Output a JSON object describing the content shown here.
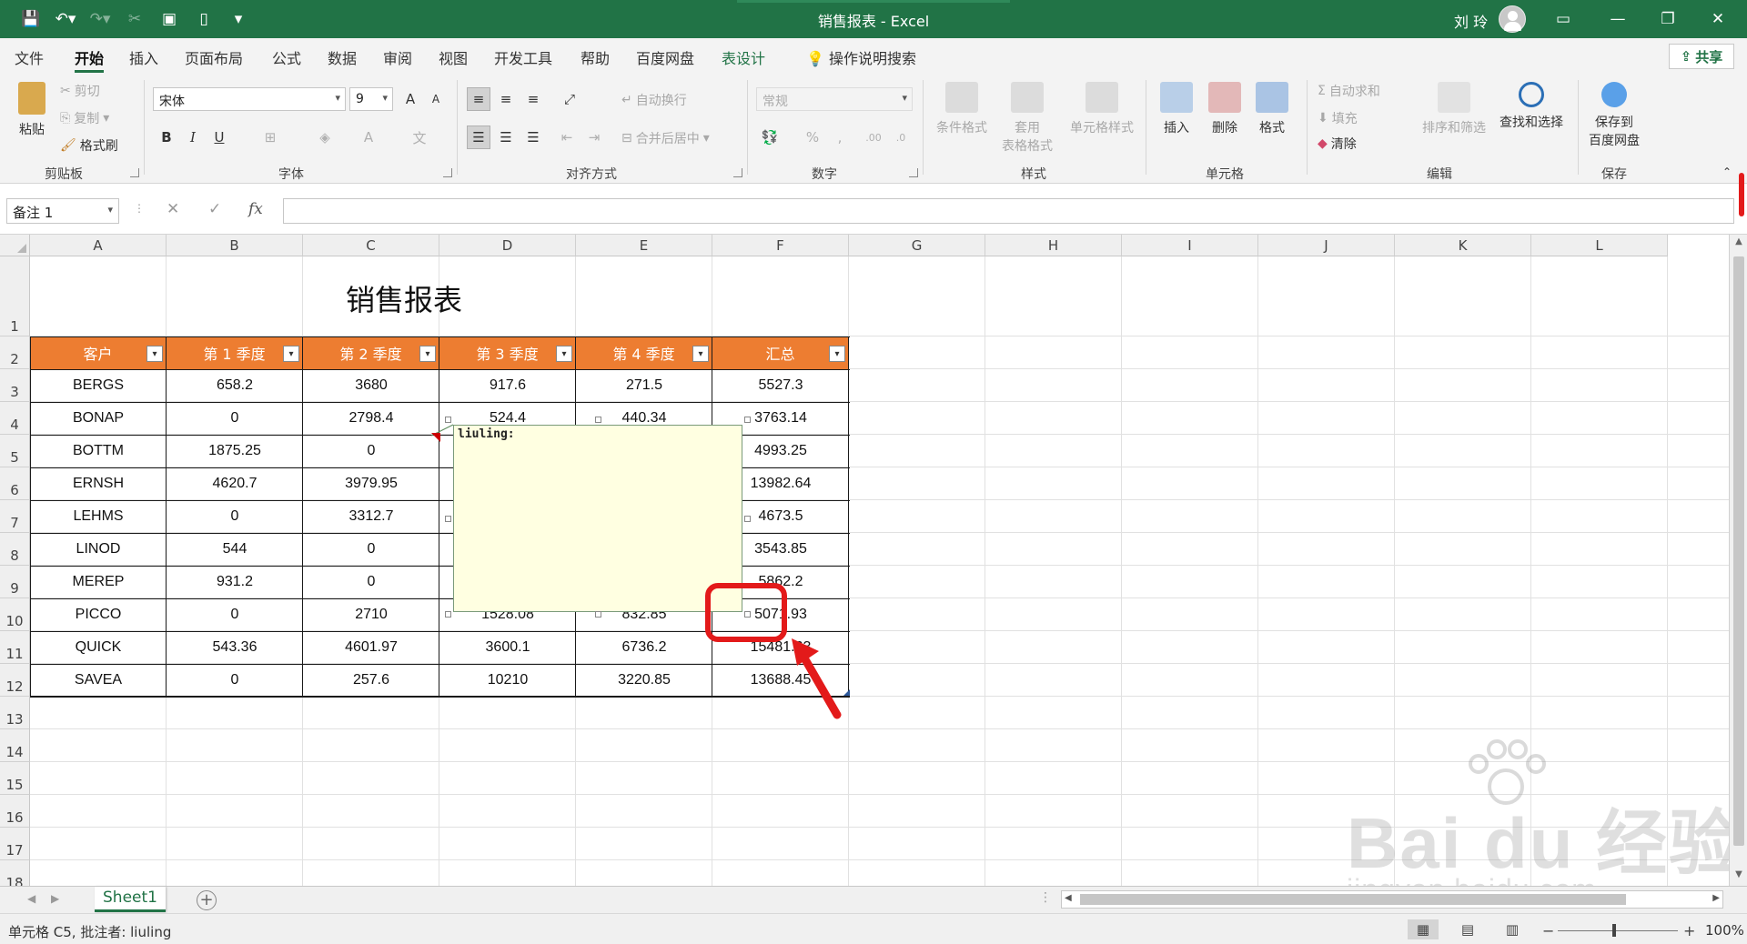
{
  "window": {
    "doc_title": "销售报表  -  Excel",
    "user": "刘 玲"
  },
  "qat": [
    "save-icon",
    "undo-icon",
    "redo-icon",
    "cut-icon",
    "print-preview-icon",
    "new-doc-icon",
    "customize-icon"
  ],
  "tabs": [
    "文件",
    "开始",
    "插入",
    "页面布局",
    "公式",
    "数据",
    "审阅",
    "视图",
    "开发工具",
    "帮助",
    "百度网盘",
    "表设计"
  ],
  "tell_me": "操作说明搜索",
  "share_label": "共享",
  "ribbon": {
    "clipboard": {
      "paste": "粘贴",
      "cut": "剪切",
      "copy": "复制",
      "format_painter": "格式刷",
      "label": "剪贴板"
    },
    "font": {
      "name": "宋体",
      "size": "9",
      "label": "字体",
      "grow": "A",
      "shrink": "A",
      "bold": "B",
      "italic": "I",
      "underline": "U",
      "font_color": "A",
      "phonetic": "文"
    },
    "alignment": {
      "wrap": "自动换行",
      "merge": "合并后居中",
      "label": "对齐方式"
    },
    "number": {
      "format": "常规",
      "percent": "%",
      "comma": ",",
      "label": "数字"
    },
    "styles": {
      "cond": "条件格式",
      "table1": "套用",
      "table2": "表格格式",
      "cell_styles": "单元格样式",
      "label": "样式"
    },
    "cells": {
      "insert": "插入",
      "delete": "删除",
      "format": "格式",
      "label": "单元格"
    },
    "editing": {
      "autosum": "自动求和",
      "fill": "填充",
      "clear": "清除",
      "sort": "排序和筛选",
      "find": "查找和选择",
      "label": "编辑"
    },
    "save": {
      "line1": "保存到",
      "line2": "百度网盘",
      "label": "保存"
    }
  },
  "formula_bar": {
    "name_box": "备注 1",
    "cancel": "✕",
    "enter": "✓",
    "fx": "fx",
    "content": ""
  },
  "columns": [
    "A",
    "B",
    "C",
    "D",
    "E",
    "F",
    "G",
    "H",
    "I",
    "J",
    "K",
    "L"
  ],
  "rows": [
    "1",
    "2",
    "3",
    "4",
    "5",
    "6",
    "7",
    "8",
    "9",
    "10",
    "11",
    "12",
    "13",
    "14",
    "15",
    "16",
    "17",
    "18"
  ],
  "sheet_title": "销售报表",
  "table": {
    "headers": [
      "客户",
      "第 1 季度",
      "第 2 季度",
      "第 3 季度",
      "第 4 季度",
      "汇总"
    ],
    "rows": [
      [
        "BERGS",
        "658.2",
        "3680",
        "917.6",
        "271.5",
        "5527.3"
      ],
      [
        "BONAP",
        "0",
        "2798.4",
        "524.4",
        "440.34",
        "3763.14"
      ],
      [
        "BOTTM",
        "1875.25",
        "0",
        "",
        "",
        "4993.25"
      ],
      [
        "ERNSH",
        "4620.7",
        "3979.95",
        "",
        "",
        "13982.64"
      ],
      [
        "LEHMS",
        "0",
        "3312.7",
        "",
        "",
        "4673.5"
      ],
      [
        "LINOD",
        "544",
        "0",
        "",
        "",
        "3543.85"
      ],
      [
        "MEREP",
        "931.2",
        "0",
        "",
        "",
        "5862.2"
      ],
      [
        "PICCO",
        "0",
        "2710",
        "1528.08",
        "832.85",
        "5071.93"
      ],
      [
        "QUICK",
        "543.36",
        "4601.97",
        "3600.1",
        "6736.2",
        "15481.63"
      ],
      [
        "SAVEA",
        "0",
        "257.6",
        "10210",
        "3220.85",
        "13688.45"
      ]
    ]
  },
  "comment": {
    "author_line": "liuling:"
  },
  "sheet_tab": "Sheet1",
  "status": {
    "message": "单元格 C5, 批注者: liuling",
    "zoom": "100%",
    "minus": "−",
    "plus": "+"
  },
  "watermark": {
    "brand": "Bai du 经验",
    "url": "jingyan.baidu.com"
  },
  "colors": {
    "excel_green": "#217346",
    "table_header": "#ed7d31",
    "comment_bg": "#ffffe1",
    "annotation_red": "#e31a1a"
  }
}
